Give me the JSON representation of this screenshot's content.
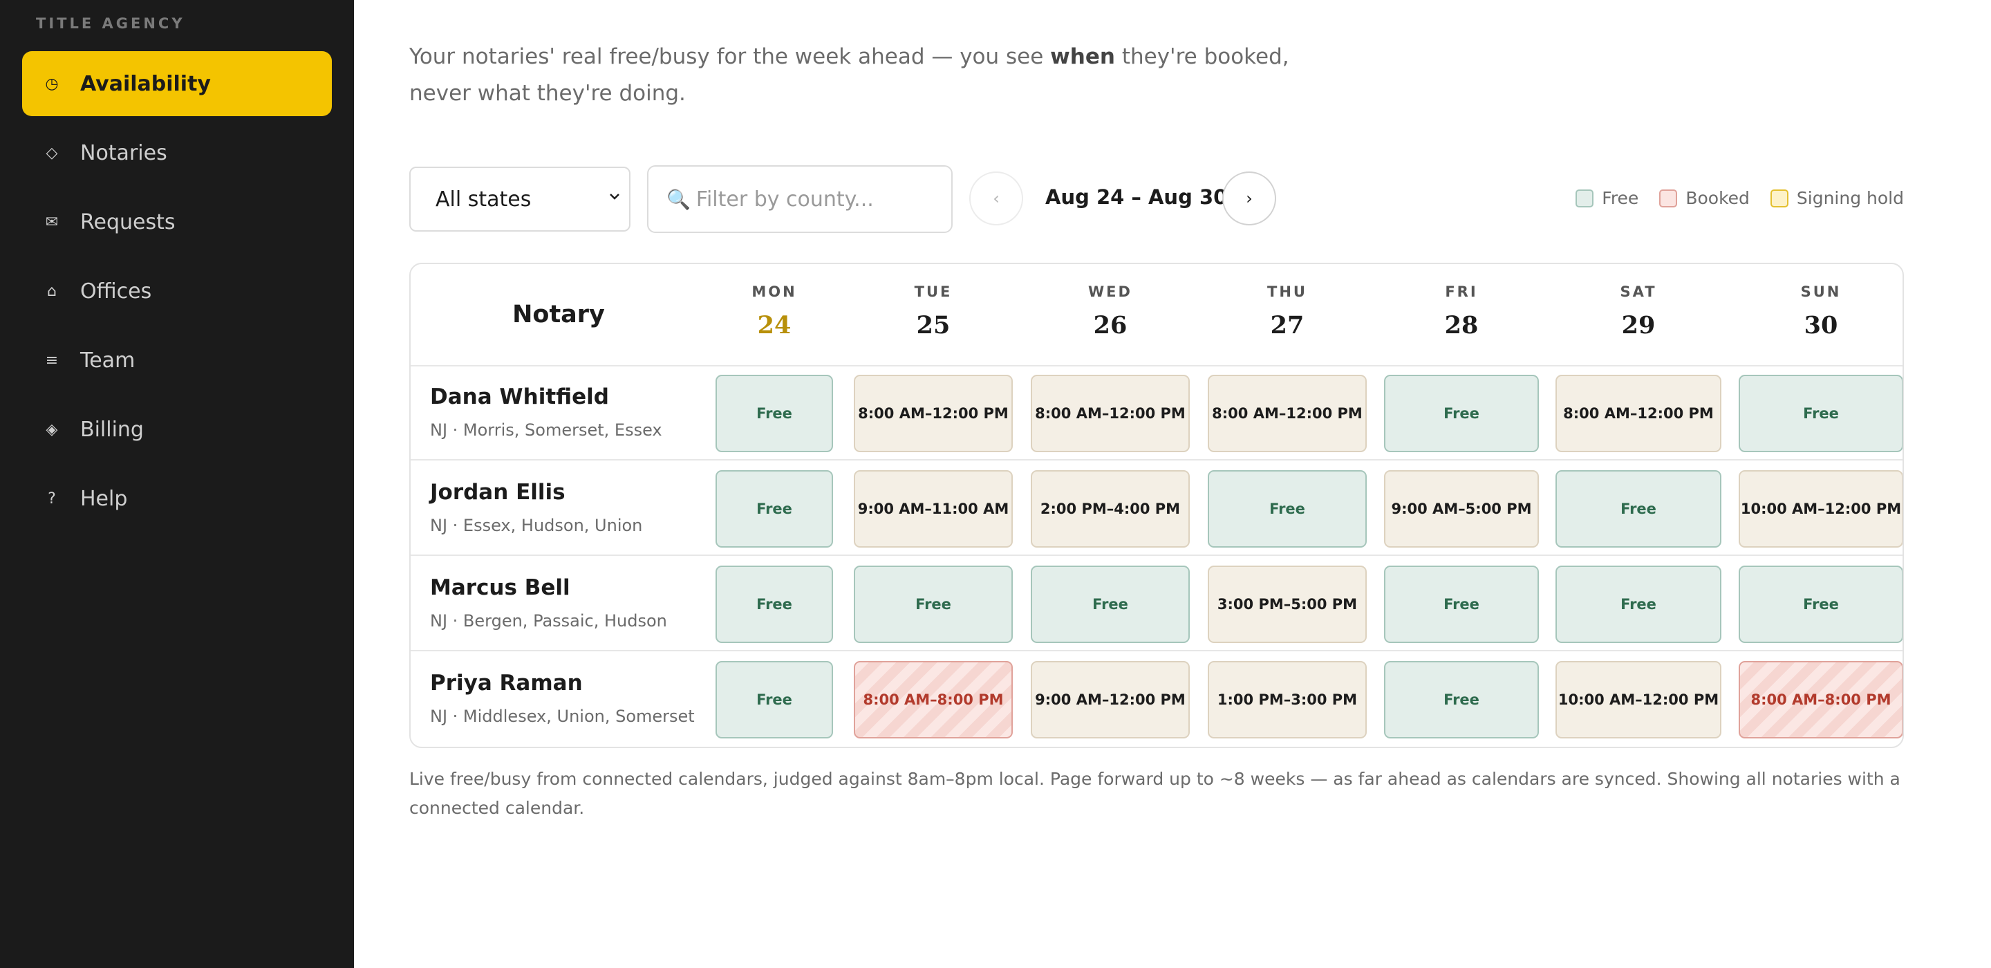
{
  "sidebar": {
    "brand": "TITLE AGENCY",
    "items": [
      {
        "label": "Availability",
        "icon": "◷",
        "active": true
      },
      {
        "label": "Notaries",
        "icon": "◇",
        "active": false
      },
      {
        "label": "Requests",
        "icon": "✉",
        "active": false
      },
      {
        "label": "Offices",
        "icon": "⌂",
        "active": false
      },
      {
        "label": "Team",
        "icon": "≡",
        "active": false
      },
      {
        "label": "Billing",
        "icon": "◈",
        "active": false
      },
      {
        "label": "Help",
        "icon": "?",
        "active": false
      }
    ]
  },
  "intro": {
    "before": "Your notaries' real free/busy for the week ahead — you see ",
    "emphasis": "when",
    "after": " they're booked, never what they're doing."
  },
  "toolbar": {
    "state_select": "All states",
    "search_icon": "🔍",
    "search_placeholder": "Filter by county...",
    "prev_label": "‹",
    "range_label": "Aug 24 – Aug 30",
    "next_label": "›"
  },
  "legend": {
    "free": "Free",
    "booked": "Booked",
    "hold": "Signing hold"
  },
  "grid": {
    "notary_header": "Notary",
    "days": [
      {
        "dow": "MON",
        "num": "24",
        "today": true
      },
      {
        "dow": "TUE",
        "num": "25",
        "today": false
      },
      {
        "dow": "WED",
        "num": "26",
        "today": false
      },
      {
        "dow": "THU",
        "num": "27",
        "today": false
      },
      {
        "dow": "FRI",
        "num": "28",
        "today": false
      },
      {
        "dow": "SAT",
        "num": "29",
        "today": false
      },
      {
        "dow": "SUN",
        "num": "30",
        "today": false
      }
    ],
    "rows": [
      {
        "name": "Dana Whitfield",
        "area": "NJ · Morris, Somerset, Essex",
        "cells": [
          {
            "status": "free",
            "label": "Free"
          },
          {
            "status": "busy",
            "label": "8:00 AM–12:00 PM"
          },
          {
            "status": "busy",
            "label": "8:00 AM–12:00 PM"
          },
          {
            "status": "busy",
            "label": "8:00 AM–12:00 PM"
          },
          {
            "status": "free",
            "label": "Free"
          },
          {
            "status": "busy",
            "label": "8:00 AM–12:00 PM"
          },
          {
            "status": "free",
            "label": "Free"
          }
        ]
      },
      {
        "name": "Jordan Ellis",
        "area": "NJ · Essex, Hudson, Union",
        "cells": [
          {
            "status": "free",
            "label": "Free"
          },
          {
            "status": "busy",
            "label": "9:00 AM–11:00 AM"
          },
          {
            "status": "busy",
            "label": "2:00 PM–4:00 PM"
          },
          {
            "status": "free",
            "label": "Free"
          },
          {
            "status": "busy",
            "label": "9:00 AM–5:00 PM"
          },
          {
            "status": "free",
            "label": "Free"
          },
          {
            "status": "busy",
            "label": "10:00 AM–12:00 PM"
          }
        ]
      },
      {
        "name": "Marcus Bell",
        "area": "NJ · Bergen, Passaic, Hudson",
        "cells": [
          {
            "status": "free",
            "label": "Free"
          },
          {
            "status": "free",
            "label": "Free"
          },
          {
            "status": "free",
            "label": "Free"
          },
          {
            "status": "busy",
            "label": "3:00 PM–5:00 PM"
          },
          {
            "status": "free",
            "label": "Free"
          },
          {
            "status": "free",
            "label": "Free"
          },
          {
            "status": "free",
            "label": "Free"
          }
        ]
      },
      {
        "name": "Priya Raman",
        "area": "NJ · Middlesex, Union, Somerset",
        "cells": [
          {
            "status": "free",
            "label": "Free"
          },
          {
            "status": "booked",
            "label": "8:00 AM–8:00 PM"
          },
          {
            "status": "busy",
            "label": "9:00 AM–12:00 PM"
          },
          {
            "status": "busy",
            "label": "1:00 PM–3:00 PM"
          },
          {
            "status": "free",
            "label": "Free"
          },
          {
            "status": "busy",
            "label": "10:00 AM–12:00 PM"
          },
          {
            "status": "booked",
            "label": "8:00 AM–8:00 PM"
          }
        ]
      }
    ]
  },
  "footnote": "Live free/busy from connected calendars, judged against 8am–8pm local. Page forward up to ~8 weeks — as far ahead as calendars are synced. Showing all notaries with a connected calendar."
}
